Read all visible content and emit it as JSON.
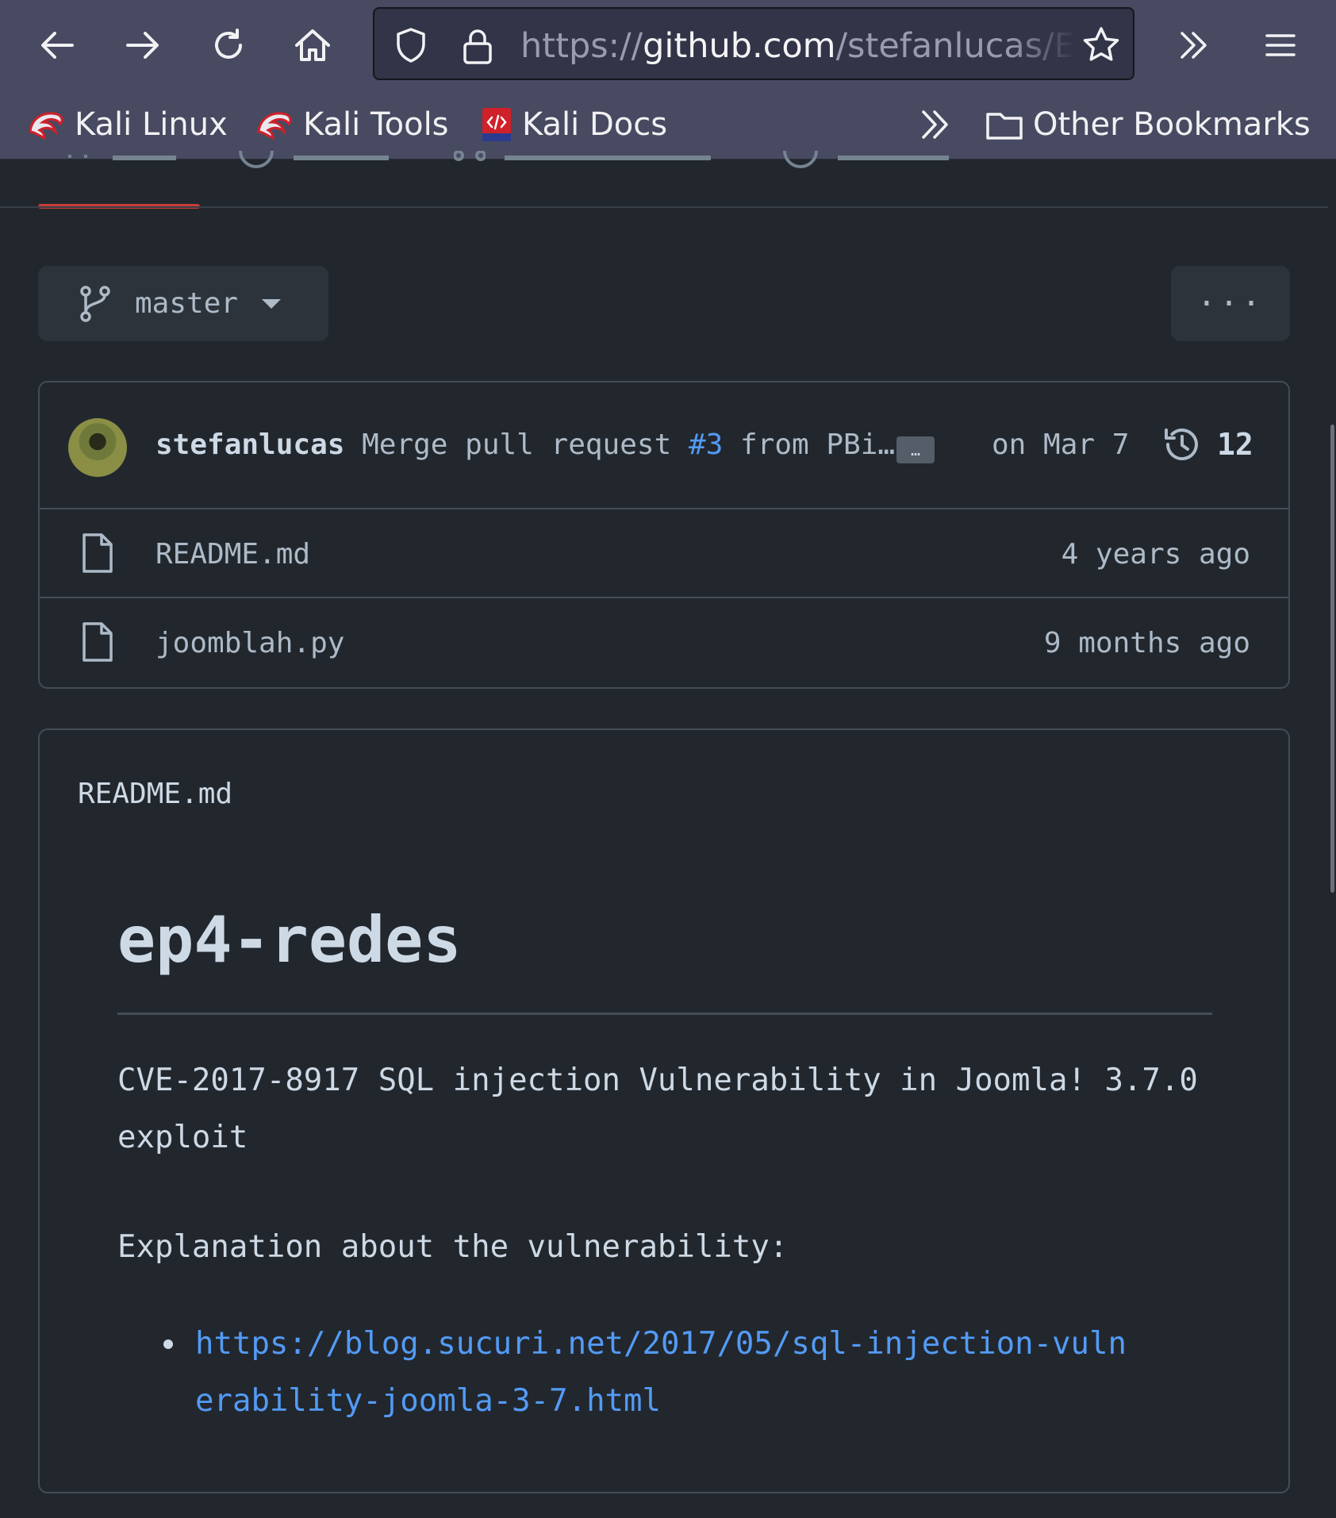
{
  "browser": {
    "url_scheme": "https://",
    "url_host": "github.com",
    "url_path": "/stefanlucas/Ex",
    "bookmarks": [
      {
        "label": "Kali Linux",
        "icon": "kali-dragon-icon"
      },
      {
        "label": "Kali Tools",
        "icon": "kali-dragon-icon"
      },
      {
        "label": "Kali Docs",
        "icon": "kali-docs-icon"
      }
    ],
    "other_bookmarks": "Other Bookmarks"
  },
  "repo": {
    "branch": "master",
    "more_label": "···",
    "commit": {
      "author": "stefanlucas",
      "message_pre": "Merge pull request",
      "pr": "#3",
      "message_post": "from PBi…",
      "ellipsis": "…",
      "date": "on Mar 7",
      "count": "12"
    },
    "files": [
      {
        "name": "README.md",
        "age": "4 years ago"
      },
      {
        "name": "joomblah.py",
        "age": "9 months ago"
      }
    ]
  },
  "readme": {
    "header": "README.md",
    "title": "ep4-redes",
    "paragraph1": "CVE-2017-8917 SQL injection Vulnerability in Joomla! 3.7.0 exploit",
    "paragraph2": "Explanation about the vulnerability:",
    "link": "https://blog.sucuri.net/2017/05/sql-injection-vulnerability-joomla-3-7.html"
  },
  "colors": {
    "accent": "#539bf5",
    "tab_underline": "#c93c37",
    "background": "#22272e",
    "chrome": "#474a60"
  }
}
